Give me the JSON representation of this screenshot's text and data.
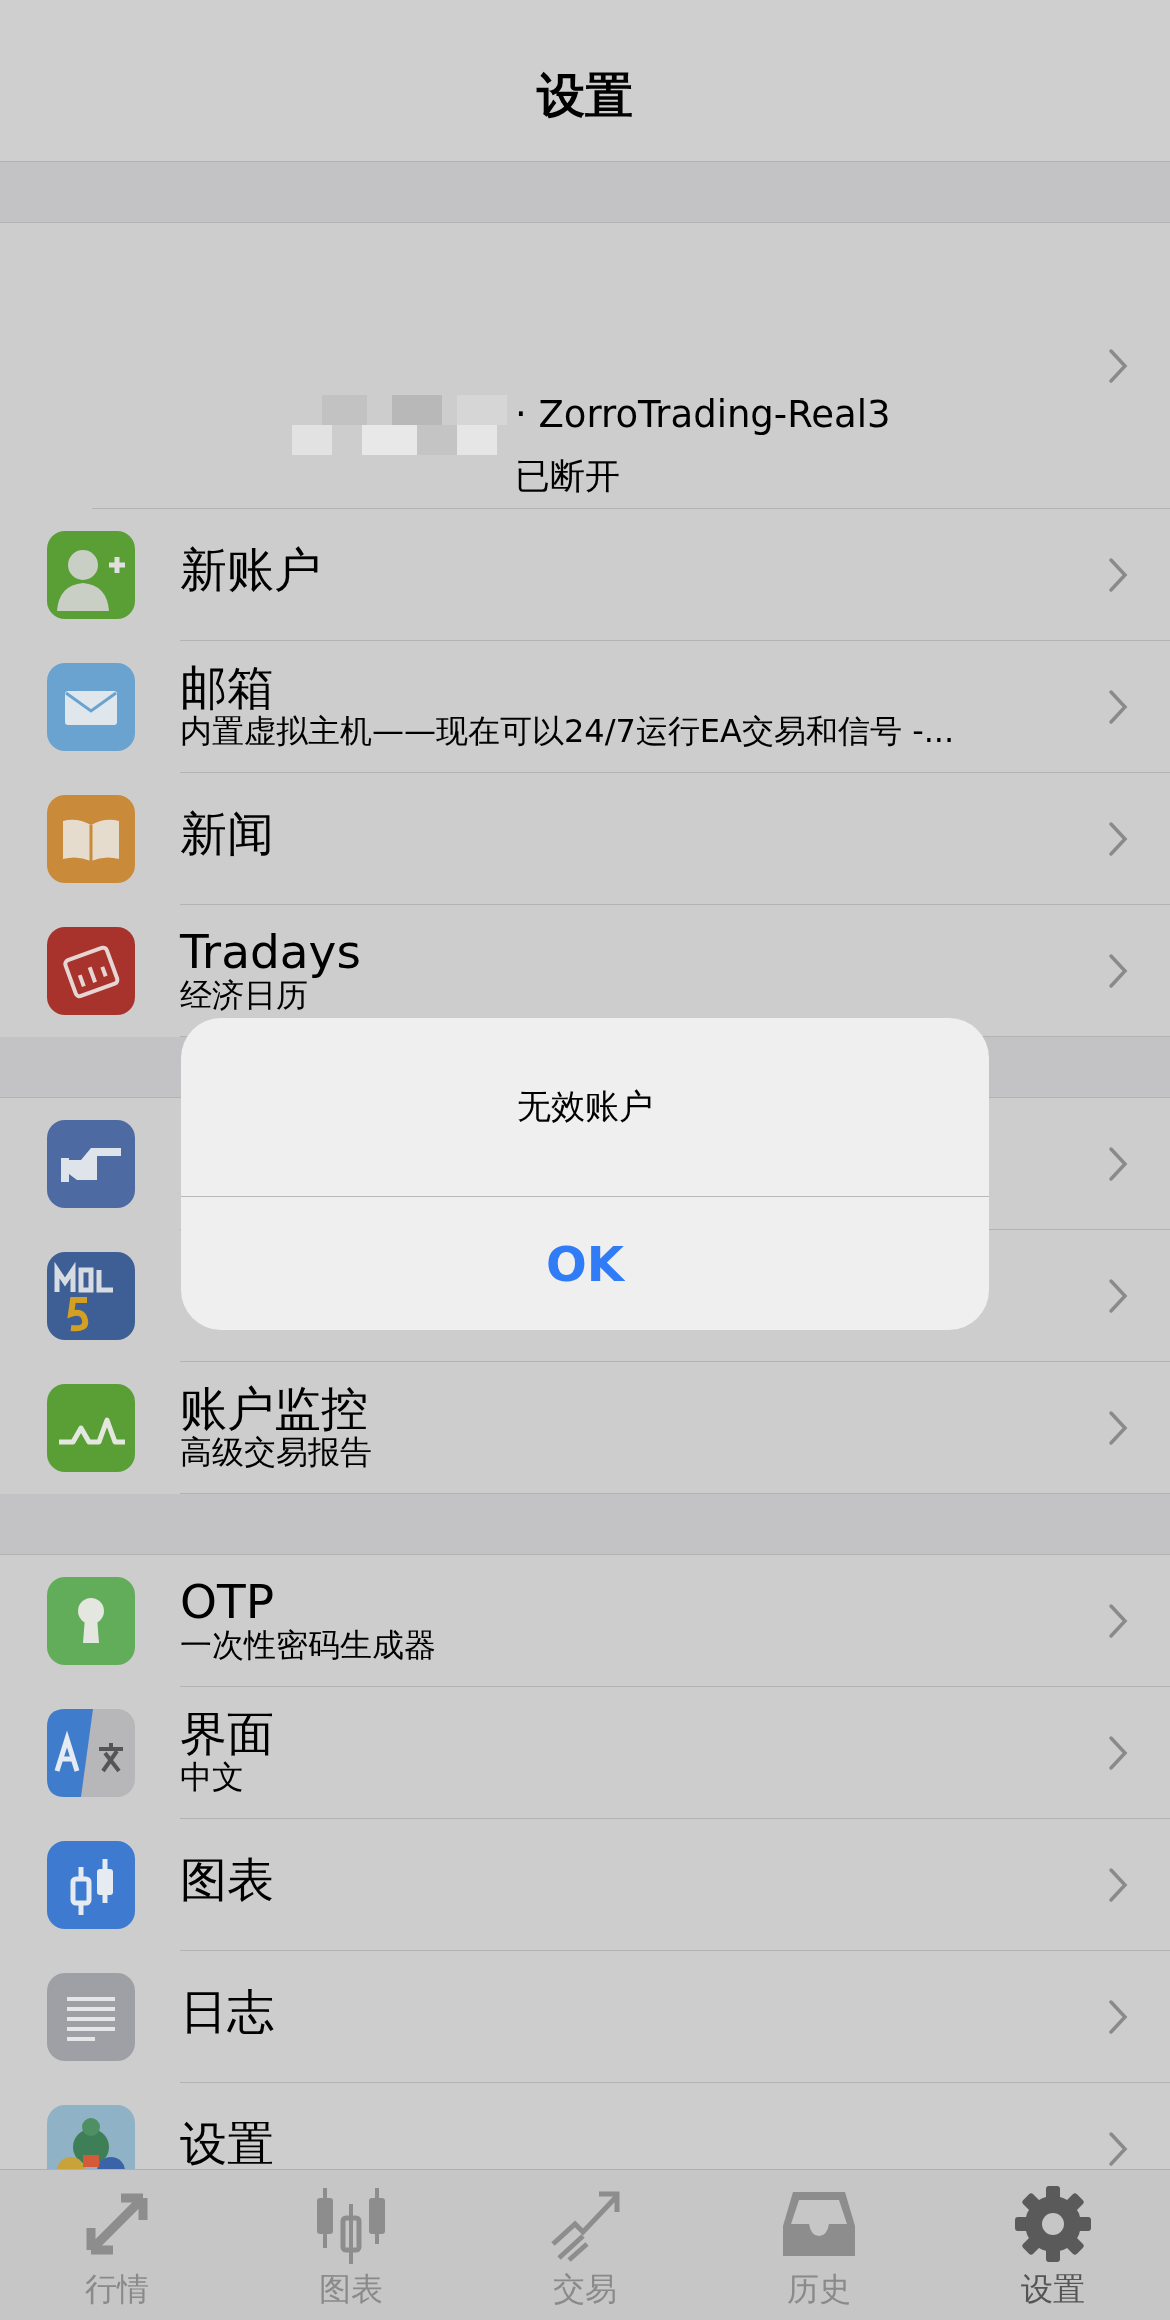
{
  "nav_bar": {
    "title": "设置"
  },
  "sections": [
    {
      "rows": [
        {
          "kind": "account",
          "title": "· ZorroTrading-Real3",
          "subtitle": "已断开"
        },
        {
          "kind": "item",
          "title": "新账户"
        },
        {
          "kind": "item",
          "title": "邮箱",
          "subtitle": "内置虚拟主机——现在可以24/7运行EA交易和信号 -..."
        },
        {
          "kind": "item",
          "title": "新闻"
        },
        {
          "kind": "item",
          "title": "Tradays",
          "subtitle": "经济日历"
        }
      ]
    },
    {
      "rows": [
        {
          "kind": "item"
        },
        {
          "kind": "item"
        },
        {
          "kind": "item",
          "title": "账户监控",
          "subtitle": "高级交易报告"
        }
      ]
    },
    {
      "rows": [
        {
          "kind": "item",
          "title": "OTP",
          "subtitle": "一次性密码生成器"
        },
        {
          "kind": "item",
          "title": "界面",
          "subtitle": "中文"
        },
        {
          "kind": "item",
          "title": "图表"
        },
        {
          "kind": "item",
          "title": "日志"
        },
        {
          "kind": "item",
          "title": "设置"
        }
      ]
    }
  ],
  "alert": {
    "message": "无效账户",
    "button": "OK"
  },
  "tab_bar": [
    {
      "label": "行情",
      "selected": false
    },
    {
      "label": "图表",
      "selected": false
    },
    {
      "label": "交易",
      "selected": false
    },
    {
      "label": "历史",
      "selected": false
    },
    {
      "label": "设置",
      "selected": true
    }
  ]
}
